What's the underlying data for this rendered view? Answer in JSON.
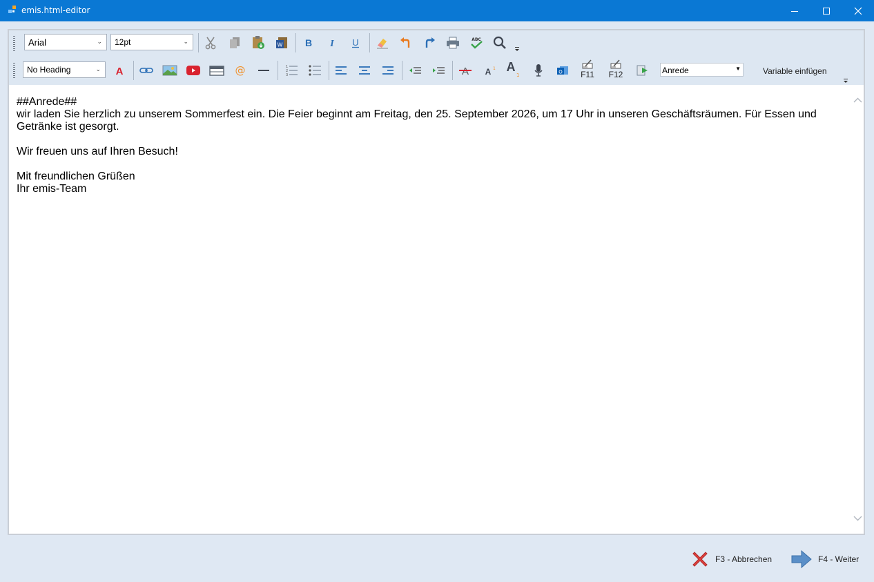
{
  "window": {
    "title": "emis.html-editor",
    "controls": {
      "minimize": "—",
      "maximize": "☐",
      "close": "✕"
    }
  },
  "toolbar": {
    "font_family": "Arial",
    "font_size": "12pt",
    "heading": "No Heading",
    "variable_select": "Anrede",
    "variable_insert_label": "Variable einfügen",
    "f11_label": "F11",
    "f12_label": "F12"
  },
  "document": {
    "lines": [
      "##Anrede##",
      "wir laden Sie herzlich zu unserem Sommerfest ein. Die Feier beginnt am Freitag, den 25. September 2026, um 17 Uhr in unseren Geschäftsräumen. Für Essen und Getränke ist gesorgt.",
      "",
      "Wir freuen uns auf Ihren Besuch!",
      "",
      "Mit freundlichen Grüßen",
      "Ihr emis-Team"
    ]
  },
  "footer": {
    "cancel": "F3 - Abbrechen",
    "next": "F4 - Weiter"
  },
  "colors": {
    "titlebar": "#0a78d4",
    "background": "#dfe8f3",
    "accent_blue": "#2b6fb6",
    "red": "#d9232f",
    "orange": "#f0a030"
  }
}
